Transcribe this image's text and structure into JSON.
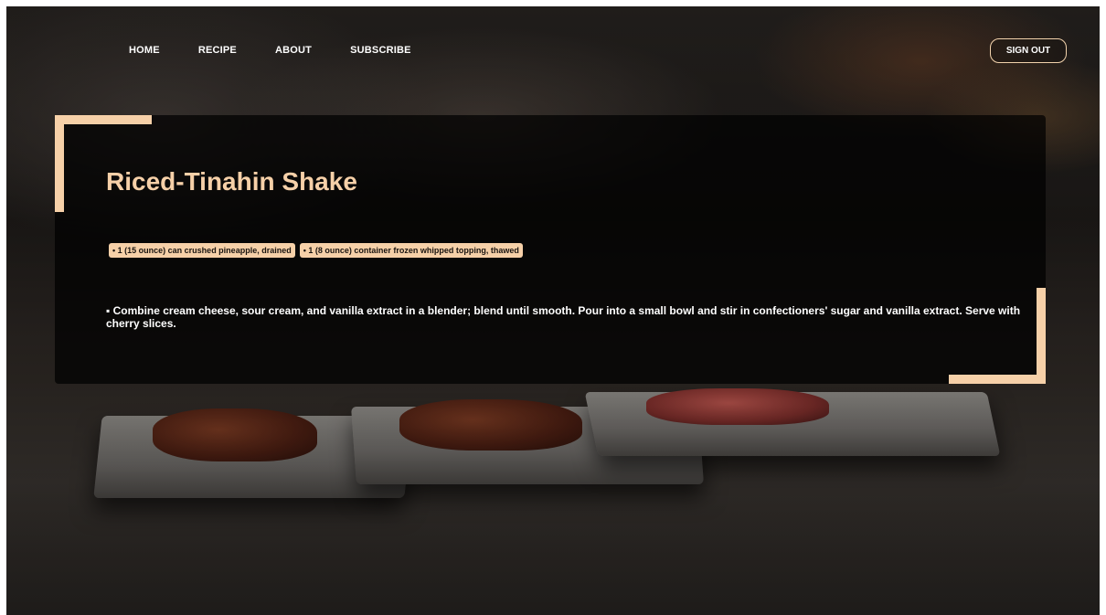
{
  "nav": {
    "items": [
      {
        "label": "HOME"
      },
      {
        "label": "RECIPE"
      },
      {
        "label": "ABOUT"
      },
      {
        "label": "SUBSCRIBE"
      }
    ],
    "signout_label": "SIGN OUT"
  },
  "recipe": {
    "title": "Riced-Tinahin Shake",
    "ingredients": [
      "• 1 (15 ounce) can crushed pineapple, drained",
      "• 1 (8 ounce) container frozen whipped topping, thawed"
    ],
    "directions": "▪ Combine cream cheese, sour cream, and vanilla extract in a blender; blend until smooth. Pour into a small bowl and stir in confectioners' sugar and vanilla extract. Serve with cherry slices."
  },
  "colors": {
    "accent": "#f6d0a8",
    "card_background": "rgba(0,0,0,0.72)",
    "text": "#ffffff"
  }
}
